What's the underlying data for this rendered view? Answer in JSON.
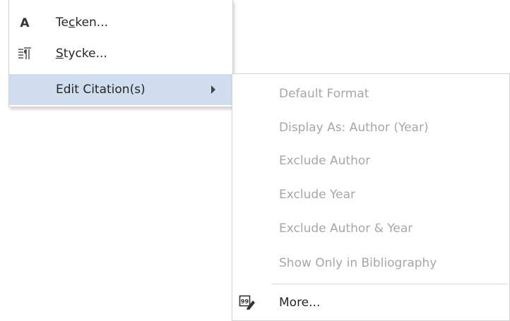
{
  "main_menu": {
    "items": [
      {
        "label_pre": "Te",
        "label_accel": "c",
        "label_post": "ken...",
        "icon": "font-A-icon"
      },
      {
        "label_pre": "",
        "label_accel": "S",
        "label_post": "tycke...",
        "icon": "paragraph-icon"
      },
      {
        "label_pre": "Edit Citation(s)",
        "label_accel": "",
        "label_post": "",
        "icon": "",
        "has_submenu": true,
        "highlighted": true
      }
    ]
  },
  "submenu": {
    "items": [
      {
        "label": "Default Format",
        "enabled": false
      },
      {
        "label": "Display As: Author (Year)",
        "enabled": false
      },
      {
        "label": "Exclude Author",
        "enabled": false
      },
      {
        "label": "Exclude Year",
        "enabled": false
      },
      {
        "label": "Exclude Author & Year",
        "enabled": false
      },
      {
        "label": "Show Only in Bibliography",
        "enabled": false
      },
      {
        "label": "More...",
        "enabled": true,
        "icon": "edit-citation-icon"
      }
    ]
  },
  "colors": {
    "highlight": "#cfddee",
    "disabled_text": "#a6a6a6",
    "text": "#262626"
  }
}
